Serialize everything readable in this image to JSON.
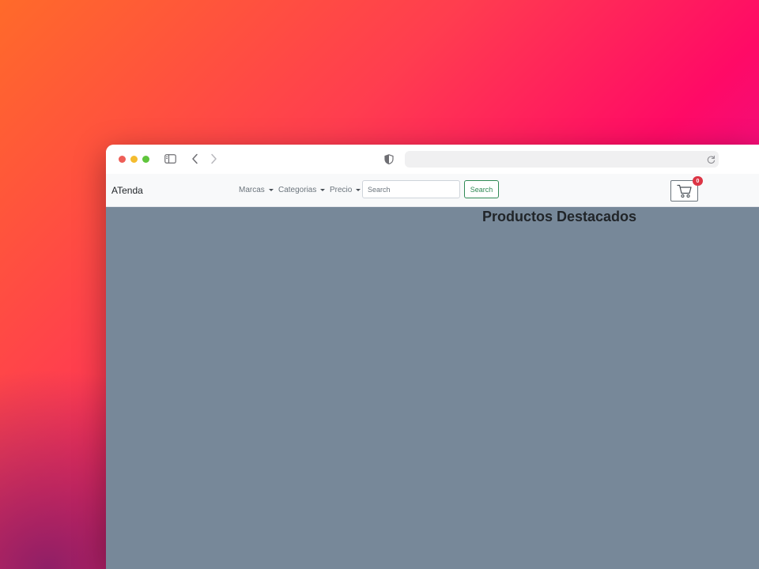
{
  "browser": {
    "url": ""
  },
  "navbar": {
    "brand": "ATenda",
    "menus": [
      {
        "label": "Marcas"
      },
      {
        "label": "Categorias"
      },
      {
        "label": "Precio"
      }
    ],
    "search": {
      "placeholder": "Search",
      "value": "",
      "button_label": "Search"
    },
    "cart": {
      "count": "0",
      "badge_color": "#dc3545"
    }
  },
  "main": {
    "title": "Productos Destacados",
    "background_color": "#778899"
  },
  "colors": {
    "success": "#2f8a55",
    "navbar_bg": "#f8f9fa"
  }
}
